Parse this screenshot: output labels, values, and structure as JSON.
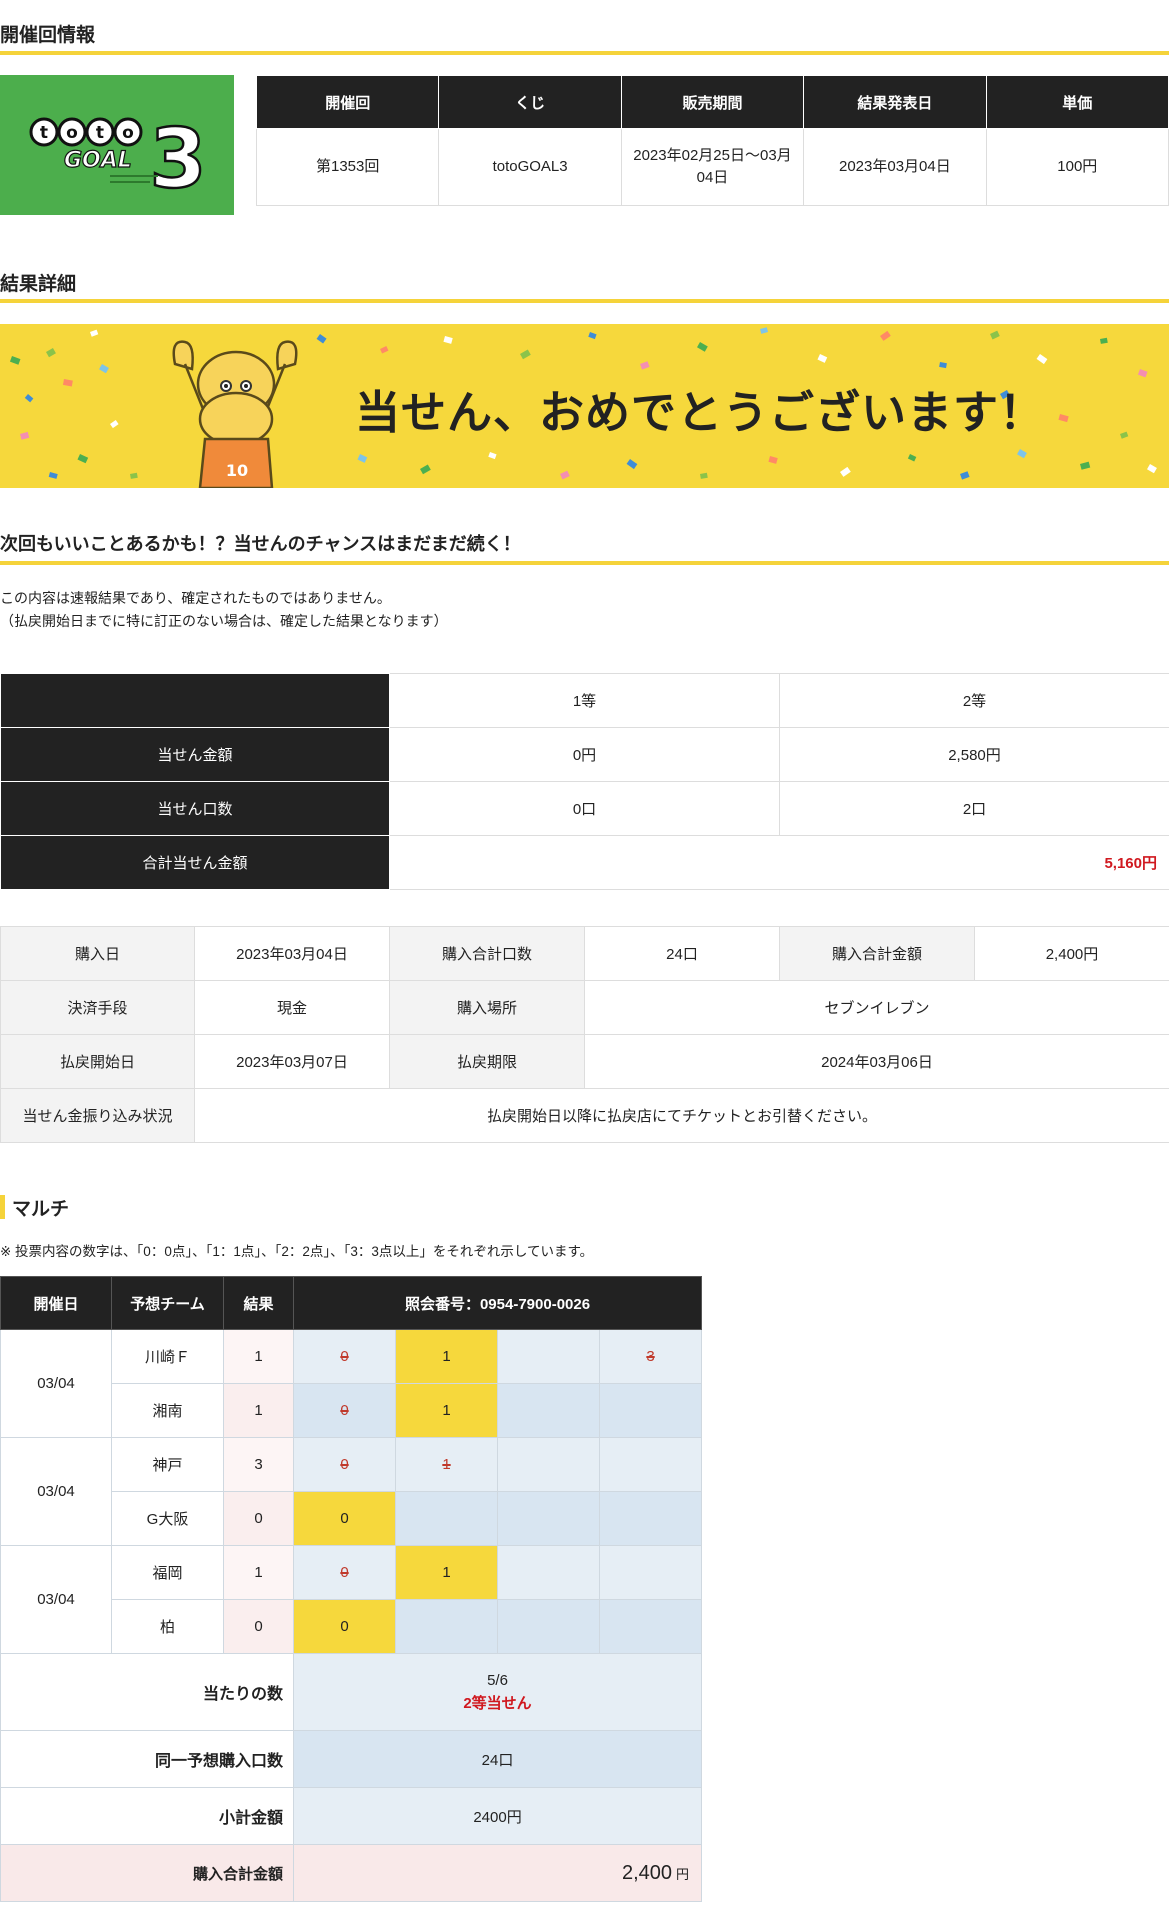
{
  "sections": {
    "event_info": "開催回情報",
    "result_detail": "結果詳細",
    "next_time": "次回もいいことあるかも！？当せんのチャンスはまだまだ続く！"
  },
  "logo": {
    "brand_top": "toto",
    "brand_mid": "GOAL",
    "brand_num": "3"
  },
  "info_table": {
    "headers": [
      "開催回",
      "くじ",
      "販売期間",
      "結果発表日",
      "単価"
    ],
    "values": [
      "第1353回",
      "totoGOAL3",
      "2023年02月25日〜03月04日",
      "2023年03月04日",
      "100円"
    ]
  },
  "banner": {
    "text": "当せん、おめでとうございます！",
    "mascot_number": "10"
  },
  "notes": {
    "line1": "この内容は速報結果であり、確定されたものではありません。",
    "line2": "（払戻開始日までに特に訂正のない場合は、確定した結果となります）"
  },
  "result_table": {
    "header": [
      "",
      "1等",
      "2等"
    ],
    "rows": [
      {
        "label": "当せん金額",
        "values": [
          "0円",
          "2,580円"
        ]
      },
      {
        "label": "当せん口数",
        "values": [
          "0口",
          "2口"
        ]
      }
    ],
    "total_label": "合計当せん金額",
    "total_value": "5,160円"
  },
  "purchase_table": {
    "purchase_date_label": "購入日",
    "purchase_date": "2023年03月04日",
    "units_label": "購入合計口数",
    "units": "24口",
    "amount_label": "購入合計金額",
    "amount": "2,400円",
    "payment_label": "決済手段",
    "payment": "現金",
    "place_label": "購入場所",
    "place": "セブンイレブン",
    "refund_start_label": "払戻開始日",
    "refund_start": "2023年03月07日",
    "refund_limit_label": "払戻期限",
    "refund_limit": "2024年03月06日",
    "transfer_label": "当せん金振り込み状況",
    "transfer": "払戻開始日以降に払戻店にてチケットとお引替ください。"
  },
  "multi": {
    "title": "マルチ",
    "note": "※ 投票内容の数字は、「0：0点」、「1：1点」、「2：2点」、「3：3点以上」をそれぞれ示しています。",
    "headers": {
      "date": "開催日",
      "team": "予想チーム",
      "result": "結果",
      "ref": "照会番号：0954-7900-0026"
    },
    "matches": [
      {
        "date": "03/04",
        "teams": [
          {
            "name": "川崎Ｆ",
            "result": "1",
            "picks": [
              "0",
              "1",
              "",
              "3"
            ]
          },
          {
            "name": "湘南",
            "result": "1",
            "picks": [
              "0",
              "1",
              "",
              ""
            ]
          }
        ]
      },
      {
        "date": "03/04",
        "teams": [
          {
            "name": "神戸",
            "result": "3",
            "picks": [
              "0",
              "1",
              "",
              ""
            ]
          },
          {
            "name": "G大阪",
            "result": "0",
            "picks": [
              "0",
              "",
              "",
              ""
            ]
          }
        ]
      },
      {
        "date": "03/04",
        "teams": [
          {
            "name": "福岡",
            "result": "1",
            "picks": [
              "0",
              "1",
              "",
              ""
            ]
          },
          {
            "name": "柏",
            "result": "0",
            "picks": [
              "0",
              "",
              "",
              ""
            ]
          }
        ]
      }
    ],
    "hits_label": "当たりの数",
    "hits_value": "5/6",
    "hits_prize": "2等当せん",
    "same_units_label": "同一予想購入口数",
    "same_units_value": "24口",
    "subtotal_label": "小計金額",
    "subtotal_value": "2400円",
    "grand_total_label": "購入合計金額",
    "grand_total_value": "2,400",
    "grand_total_unit": "円"
  },
  "colors": {
    "accent": "#f5d33a",
    "dark": "#222222",
    "win_red": "#d0181f",
    "logo_green": "#4cae4c"
  }
}
